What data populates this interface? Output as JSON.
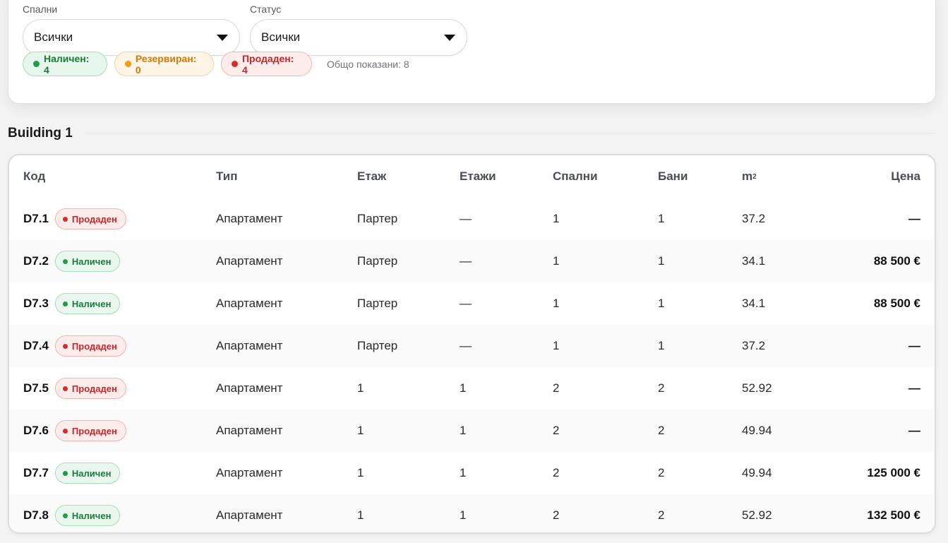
{
  "filters": {
    "bedrooms": {
      "label": "Спални",
      "value": "Всички"
    },
    "status": {
      "label": "Статус",
      "value": "Всички"
    }
  },
  "summary": {
    "available": "Наличен: 4",
    "reserved": "Резервиран: 0",
    "sold": "Продаден: 4",
    "total": "Общо показани: 8"
  },
  "colors": {
    "available": "#1f9d48",
    "reserved": "#f39c12",
    "sold": "#d62d2d"
  },
  "section": {
    "title": "Building 1"
  },
  "table": {
    "headers": {
      "code": "Код",
      "type": "Тип",
      "floor": "Етаж",
      "floors": "Етажи",
      "bedrooms": "Спални",
      "bathrooms": "Бани",
      "area_unit": "m",
      "area_exp": "2",
      "price": "Цена"
    },
    "rows": [
      {
        "code": "D7.1",
        "status": "Продаден",
        "status_key": "sold",
        "type": "Апартамент",
        "floor": "Партер",
        "floors": "—",
        "bedrooms": "1",
        "bathrooms": "1",
        "area": "37.2",
        "price": "—"
      },
      {
        "code": "D7.2",
        "status": "Наличен",
        "status_key": "available",
        "type": "Апартамент",
        "floor": "Партер",
        "floors": "—",
        "bedrooms": "1",
        "bathrooms": "1",
        "area": "34.1",
        "price": "88 500 €"
      },
      {
        "code": "D7.3",
        "status": "Наличен",
        "status_key": "available",
        "type": "Апартамент",
        "floor": "Партер",
        "floors": "—",
        "bedrooms": "1",
        "bathrooms": "1",
        "area": "34.1",
        "price": "88 500 €"
      },
      {
        "code": "D7.4",
        "status": "Продаден",
        "status_key": "sold",
        "type": "Апартамент",
        "floor": "Партер",
        "floors": "—",
        "bedrooms": "1",
        "bathrooms": "1",
        "area": "37.2",
        "price": "—"
      },
      {
        "code": "D7.5",
        "status": "Продаден",
        "status_key": "sold",
        "type": "Апартамент",
        "floor": "1",
        "floors": "1",
        "bedrooms": "2",
        "bathrooms": "2",
        "area": "52.92",
        "price": "—"
      },
      {
        "code": "D7.6",
        "status": "Продаден",
        "status_key": "sold",
        "type": "Апартамент",
        "floor": "1",
        "floors": "1",
        "bedrooms": "2",
        "bathrooms": "2",
        "area": "49.94",
        "price": "—"
      },
      {
        "code": "D7.7",
        "status": "Наличен",
        "status_key": "available",
        "type": "Апартамент",
        "floor": "1",
        "floors": "1",
        "bedrooms": "2",
        "bathrooms": "2",
        "area": "49.94",
        "price": "125 000 €"
      },
      {
        "code": "D7.8",
        "status": "Наличен",
        "status_key": "available",
        "type": "Апартамент",
        "floor": "1",
        "floors": "1",
        "bedrooms": "2",
        "bathrooms": "2",
        "area": "52.92",
        "price": "132 500 €"
      }
    ]
  }
}
